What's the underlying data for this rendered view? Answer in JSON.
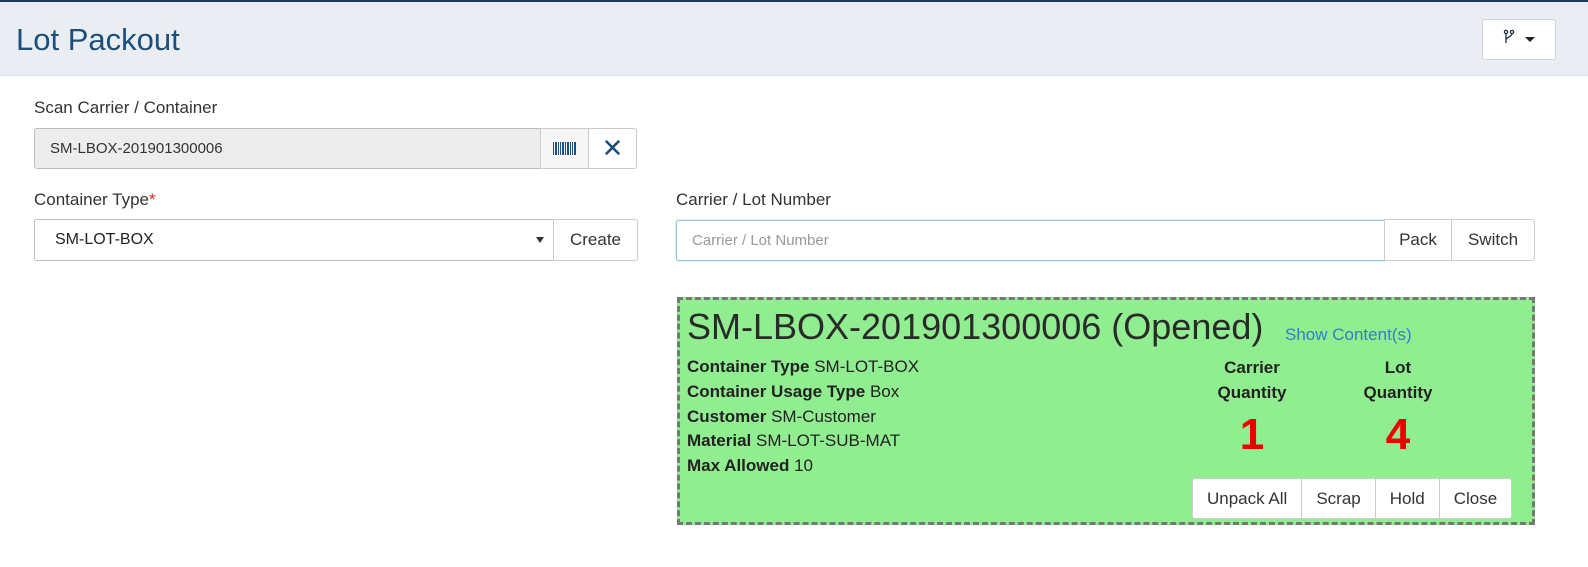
{
  "header": {
    "title": "Lot Packout",
    "menu_icon": "branch-icon"
  },
  "scan": {
    "label": "Scan Carrier / Container",
    "value": "SM-LBOX-201901300006",
    "barcode_icon": "barcode-icon",
    "clear_icon": "close-icon",
    "clear_glyph": "✕"
  },
  "container_type": {
    "label": "Container Type",
    "required_mark": "*",
    "selected": "SM-LOT-BOX",
    "create_label": "Create"
  },
  "lot": {
    "label": "Carrier / Lot Number",
    "placeholder": "Carrier / Lot Number",
    "value": "",
    "pack_label": "Pack",
    "switch_label": "Switch"
  },
  "container_card": {
    "background_color": "#90ee90",
    "title": "SM-LBOX-201901300006 (Opened)",
    "show_contents_label": "Show Content(s)",
    "fields": [
      {
        "label": "Container Type",
        "value": "SM-LOT-BOX"
      },
      {
        "label": "Container Usage Type",
        "value": "Box"
      },
      {
        "label": "Customer",
        "value": "SM-Customer"
      },
      {
        "label": "Material",
        "value": "SM-LOT-SUB-MAT"
      },
      {
        "label": "Max Allowed",
        "value": "10"
      }
    ],
    "carrier_quantity": {
      "label_line1": "Carrier",
      "label_line2": "Quantity",
      "value": "1"
    },
    "lot_quantity": {
      "label_line1": "Lot",
      "label_line2": "Quantity",
      "value": "4"
    },
    "quantity_color": "#ee0000",
    "actions": [
      "Unpack All",
      "Scrap",
      "Hold",
      "Close"
    ]
  }
}
